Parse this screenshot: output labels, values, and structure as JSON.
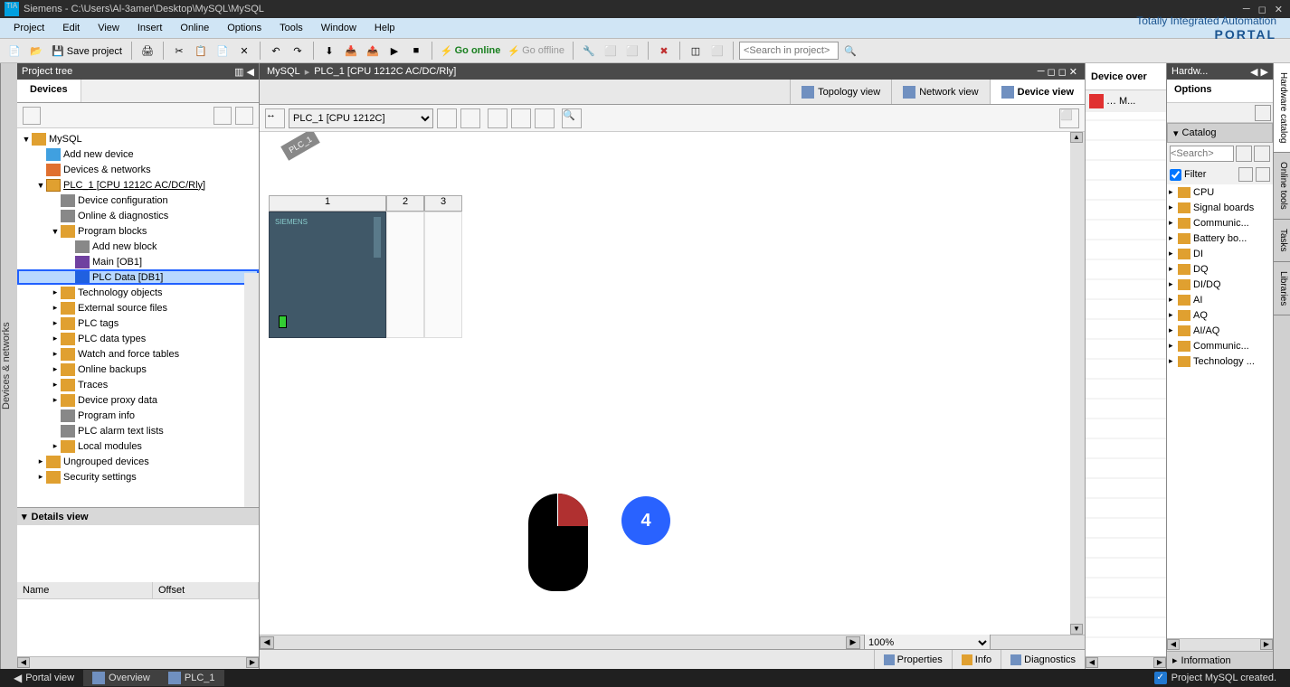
{
  "title": "Siemens  -  C:\\Users\\Al-3amer\\Desktop\\MySQL\\MySQL",
  "menu": [
    "Project",
    "Edit",
    "View",
    "Insert",
    "Online",
    "Options",
    "Tools",
    "Window",
    "Help"
  ],
  "brand": {
    "line1": "Totally Integrated Automation",
    "line2": "PORTAL"
  },
  "toolbar": {
    "save": "Save project",
    "go_online": "Go online",
    "go_offline": "Go offline",
    "search_ph": "<Search in project>"
  },
  "project_tree": {
    "header": "Project tree",
    "tab": "Devices",
    "root": "MySQL",
    "items": [
      {
        "label": "Add new device",
        "icon": "icon-device",
        "indent": 1
      },
      {
        "label": "Devices & networks",
        "icon": "icon-net",
        "indent": 1
      },
      {
        "label": "PLC_1 [CPU 1212C AC/DC/Rly]",
        "icon": "icon-plc",
        "indent": 1,
        "expanded": true,
        "underline": true
      },
      {
        "label": "Device configuration",
        "icon": "icon-generic",
        "indent": 2
      },
      {
        "label": "Online & diagnostics",
        "icon": "icon-generic",
        "indent": 2
      },
      {
        "label": "Program blocks",
        "icon": "icon-folder",
        "indent": 2,
        "expanded": true
      },
      {
        "label": "Add new block",
        "icon": "icon-generic",
        "indent": 3
      },
      {
        "label": "Main [OB1]",
        "icon": "icon-block",
        "indent": 3
      },
      {
        "label": "PLC Data [DB1]",
        "icon": "icon-db",
        "indent": 3,
        "selected": true
      },
      {
        "label": "Technology objects",
        "icon": "icon-folder",
        "indent": 2,
        "arrow": true
      },
      {
        "label": "External source files",
        "icon": "icon-folder",
        "indent": 2,
        "arrow": true
      },
      {
        "label": "PLC tags",
        "icon": "icon-folder",
        "indent": 2,
        "arrow": true
      },
      {
        "label": "PLC data types",
        "icon": "icon-folder",
        "indent": 2,
        "arrow": true
      },
      {
        "label": "Watch and force tables",
        "icon": "icon-folder",
        "indent": 2,
        "arrow": true
      },
      {
        "label": "Online backups",
        "icon": "icon-folder",
        "indent": 2,
        "arrow": true
      },
      {
        "label": "Traces",
        "icon": "icon-folder",
        "indent": 2,
        "arrow": true
      },
      {
        "label": "Device proxy data",
        "icon": "icon-folder",
        "indent": 2,
        "arrow": true
      },
      {
        "label": "Program info",
        "icon": "icon-generic",
        "indent": 2
      },
      {
        "label": "PLC alarm text lists",
        "icon": "icon-generic",
        "indent": 2
      },
      {
        "label": "Local modules",
        "icon": "icon-folder",
        "indent": 2,
        "arrow": true
      },
      {
        "label": "Ungrouped devices",
        "icon": "icon-folder",
        "indent": 1,
        "arrow": true
      },
      {
        "label": "Security settings",
        "icon": "icon-folder",
        "indent": 1,
        "arrow": true
      }
    ],
    "details_view": "Details view",
    "details_cols": [
      "Name",
      "Offset"
    ]
  },
  "side_tab_left": "Devices & networks",
  "breadcrumb": [
    "MySQL",
    "PLC_1 [CPU 1212C AC/DC/Rly]"
  ],
  "view_tabs": [
    {
      "label": "Topology view"
    },
    {
      "label": "Network view"
    },
    {
      "label": "Device view",
      "active": true
    }
  ],
  "editor": {
    "device_select": "PLC_1 [CPU 1212C]",
    "rack_label": "PLC_1",
    "slots": [
      "1",
      "2",
      "3"
    ],
    "plc_brand": "SIEMENS"
  },
  "callout": "4",
  "zoom": "100%",
  "bottom_tabs": [
    {
      "label": "Properties"
    },
    {
      "label": "Info"
    },
    {
      "label": "Diagnostics"
    }
  ],
  "device_overview": {
    "header": "Device over",
    "mini": "M..."
  },
  "hardware": {
    "header": "Hardw...",
    "options": "Options",
    "catalog": "Catalog",
    "search_ph": "<Search>",
    "filter": "Filter",
    "items": [
      "CPU",
      "Signal boards",
      "Communic...",
      "Battery bo...",
      "DI",
      "DQ",
      "DI/DQ",
      "AI",
      "AQ",
      "AI/AQ",
      "Communic...",
      "Technology ..."
    ],
    "information": "Information"
  },
  "far_right_tabs": [
    "Hardware catalog",
    "Online tools",
    "Tasks",
    "Libraries"
  ],
  "status_bar": {
    "portal_view": "Portal view",
    "overview": "Overview",
    "plc": "PLC_1",
    "message": "Project MySQL created."
  }
}
